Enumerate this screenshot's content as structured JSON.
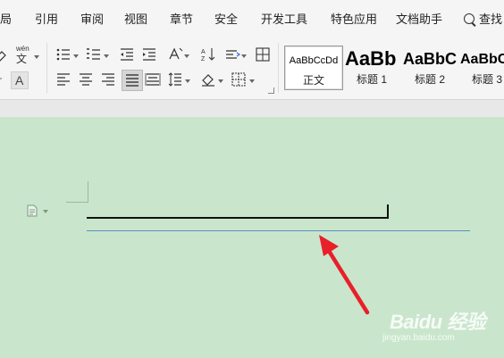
{
  "tabs": [
    {
      "id": "layout",
      "label": "布局"
    },
    {
      "id": "references",
      "label": "引用"
    },
    {
      "id": "review",
      "label": "审阅"
    },
    {
      "id": "view",
      "label": "视图"
    },
    {
      "id": "sections",
      "label": "章节"
    },
    {
      "id": "security",
      "label": "安全"
    },
    {
      "id": "developer",
      "label": "开发工具"
    },
    {
      "id": "special",
      "label": "特色应用"
    },
    {
      "id": "doc_assistant",
      "label": "文档助手"
    },
    {
      "id": "search",
      "label": "查找"
    }
  ],
  "toolbar": {
    "phonetic_icon_text": "wén",
    "phonetic_char": "文",
    "char_shading_text": "A",
    "line_spacing_icon": "line-spacing-icon",
    "border_icon": "border-icon"
  },
  "styles": [
    {
      "sample": "AaBbCcDd",
      "name": "正文",
      "selected": true
    },
    {
      "sample": "AaBb",
      "name": "标题 1",
      "selected": false
    },
    {
      "sample": "AaBbC",
      "name": "标题 2",
      "selected": false
    },
    {
      "sample": "AaBbC",
      "name": "标题 3",
      "selected": false
    }
  ],
  "watermark": {
    "brand": "Baidu 经验",
    "url": "jingyan.baidu.com"
  },
  "colors": {
    "ribbon_bg": "#f5f5f5",
    "doc_bg": "#c9e6cc",
    "arrow": "#e8202a",
    "hr_blue": "#5b8fc5"
  }
}
